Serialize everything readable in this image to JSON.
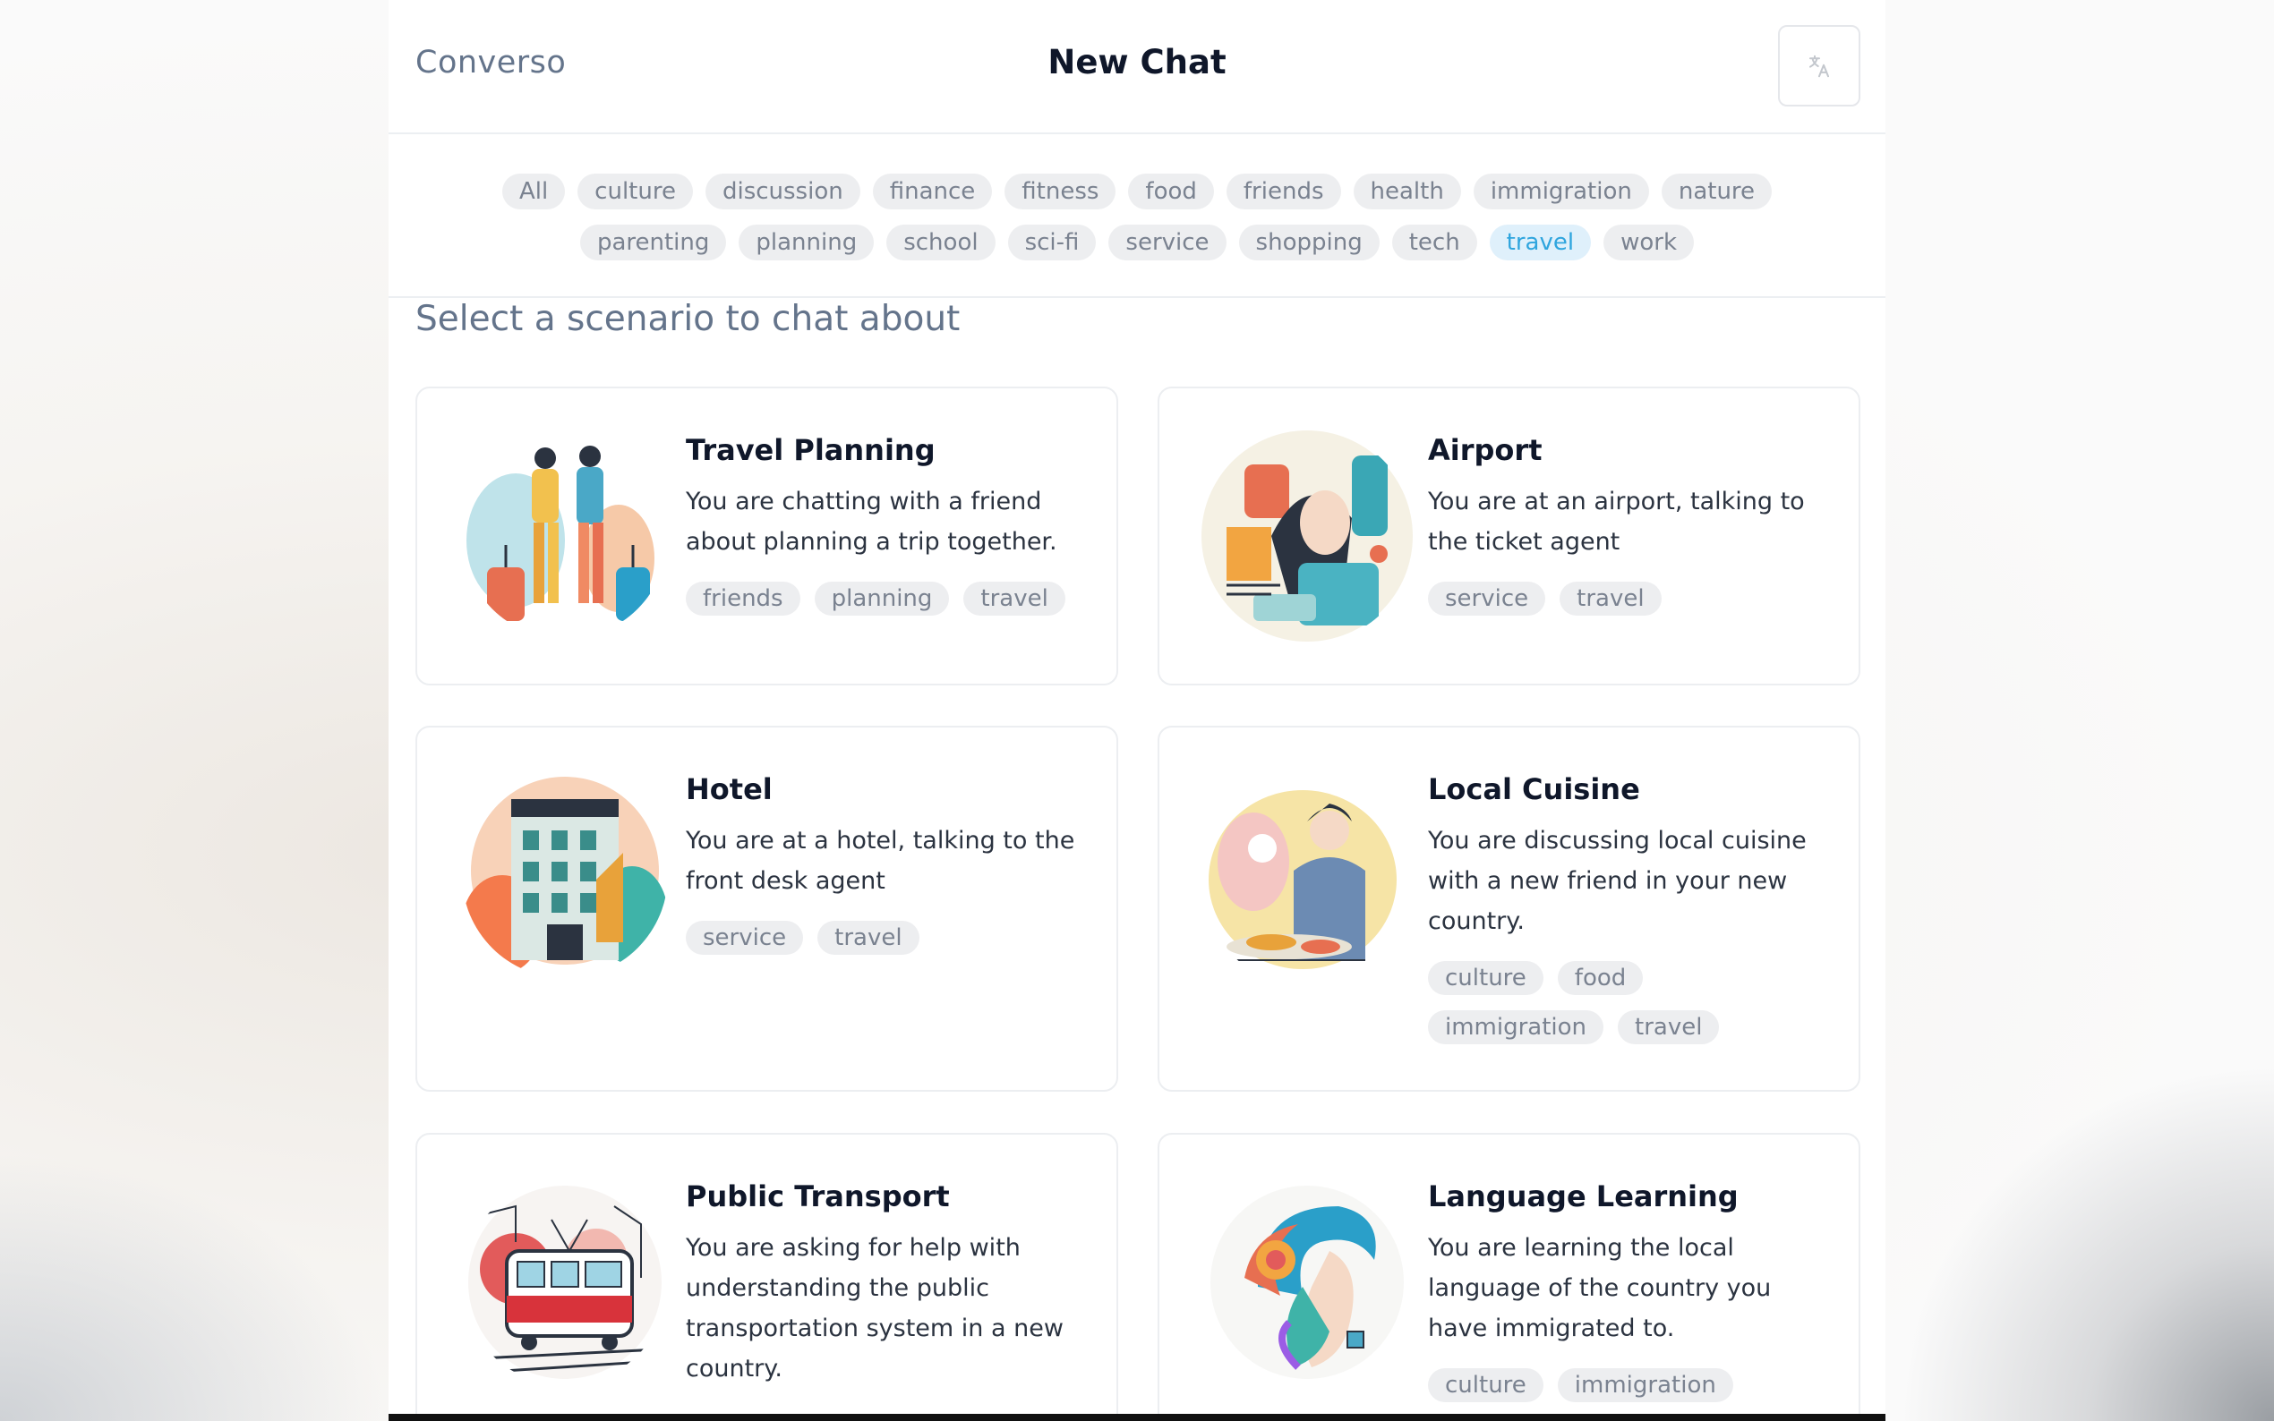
{
  "header": {
    "brand": "Converso",
    "title": "New Chat",
    "language_icon": "translate-icon"
  },
  "filters": [
    "All",
    "culture",
    "discussion",
    "finance",
    "fitness",
    "food",
    "friends",
    "health",
    "immigration",
    "nature",
    "parenting",
    "planning",
    "school",
    "sci-fi",
    "service",
    "shopping",
    "tech",
    "travel",
    "work"
  ],
  "active_filter": "travel",
  "subtitle": "Select a scenario to chat about",
  "scenarios": [
    {
      "title": "Travel Planning",
      "description": "You are chatting with a friend about planning a trip together.",
      "tags": [
        "friends",
        "planning",
        "travel"
      ]
    },
    {
      "title": "Airport",
      "description": "You are at an airport, talking to the ticket agent",
      "tags": [
        "service",
        "travel"
      ]
    },
    {
      "title": "Hotel",
      "description": "You are at a hotel, talking to the front desk agent",
      "tags": [
        "service",
        "travel"
      ]
    },
    {
      "title": "Local Cuisine",
      "description": "You are discussing local cuisine with a new friend in your new country.",
      "tags": [
        "culture",
        "food",
        "immigration",
        "travel"
      ]
    },
    {
      "title": "Public Transport",
      "description": "You are asking for help with understanding the public transportation system in a new country.",
      "tags": []
    },
    {
      "title": "Language Learning",
      "description": "You are learning the local language of the country you have immigrated to.",
      "tags": [
        "culture",
        "immigration"
      ]
    }
  ],
  "colors": {
    "active_chip_bg": "#dff0fb",
    "active_chip_text": "#2fa5de"
  }
}
